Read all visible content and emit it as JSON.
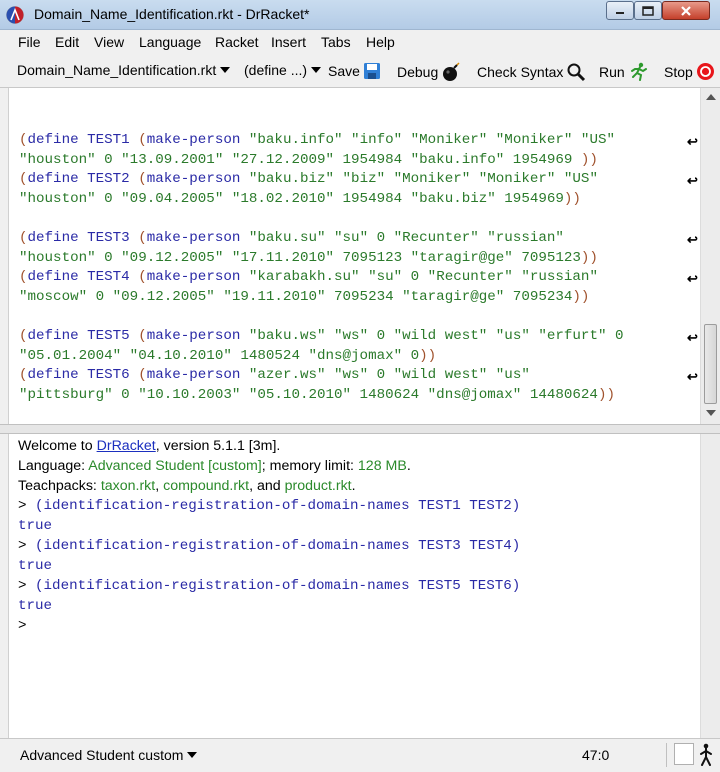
{
  "window": {
    "title": "Domain_Name_Identification.rkt - DrRacket*"
  },
  "menu": [
    "File",
    "Edit",
    "View",
    "Language",
    "Racket",
    "Insert",
    "Tabs",
    "Help"
  ],
  "toolbar": {
    "file_selector": "Domain_Name_Identification.rkt",
    "define_selector": "(define ...)",
    "save": "Save",
    "debug": "Debug",
    "check_syntax": "Check Syntax",
    "run": "Run",
    "stop": "Stop"
  },
  "editor": {
    "lines": [
      "(define TEST1 (make-person \"baku.info\" \"info\" \"Moniker\" \"Moniker\" \"US\"",
      "\"houston\" 0 \"13.09.2001\" \"27.12.2009\" 1954984 \"baku.info\" 1954969 ))",
      "(define TEST2 (make-person \"baku.biz\" \"biz\" \"Moniker\" \"Moniker\" \"US\"",
      "\"houston\" 0 \"09.04.2005\" \"18.02.2010\" 1954984 \"baku.biz\" 1954969))",
      "",
      "(define TEST3 (make-person \"baku.su\" \"su\" 0 \"Recunter\" \"russian\"",
      "\"houston\" 0 \"09.12.2005\" \"17.11.2010\" 7095123 \"taragir@ge\" 7095123))",
      "(define TEST4 (make-person \"karabakh.su\" \"su\" 0 \"Recunter\" \"russian\"",
      "\"moscow\" 0 \"09.12.2005\" \"19.11.2010\" 7095234 \"taragir@ge\" 7095234))",
      "",
      "(define TEST5 (make-person \"baku.ws\" \"ws\" 0 \"wild west\" \"us\" \"erfurt\" 0",
      "\"05.01.2004\" \"04.10.2010\" 1480524 \"dns@jomax\" 0))",
      "(define TEST6 (make-person \"azer.ws\" \"ws\" 0 \"wild west\" \"us\"",
      "\"pittsburg\" 0 \"10.10.2003\" \"05.10.2010\" 1480624 \"dns@jomax\" 14480624))"
    ],
    "wrap_arrow": "↩"
  },
  "repl": {
    "welcome_prefix": "Welcome to ",
    "welcome_link": "DrRacket",
    "welcome_suffix": ", version 5.1.1 [3m].",
    "language_prefix": "Language: ",
    "language_value": "Advanced Student [custom]",
    "language_mid": "; memory limit: ",
    "memory_value": "128 MB",
    "language_end": ".",
    "teachpacks_prefix": "Teachpacks: ",
    "teachpack1": "taxon.rkt",
    "teachpack_sep1": ", ",
    "teachpack2": "compound.rkt",
    "teachpack_sep2": ", and ",
    "teachpack3": "product.rkt",
    "teachpacks_end": ".",
    "interactions": [
      {
        "prompt": ">",
        "input": "(identification-registration-of-domain-names TEST1 TEST2)",
        "output": "true"
      },
      {
        "prompt": ">",
        "input": "(identification-registration-of-domain-names TEST3 TEST4)",
        "output": "true"
      },
      {
        "prompt": ">",
        "input": "(identification-registration-of-domain-names TEST5 TEST6)",
        "output": "true"
      }
    ],
    "final_prompt": ">"
  },
  "status": {
    "language": "Advanced Student custom",
    "position": "47:0"
  }
}
